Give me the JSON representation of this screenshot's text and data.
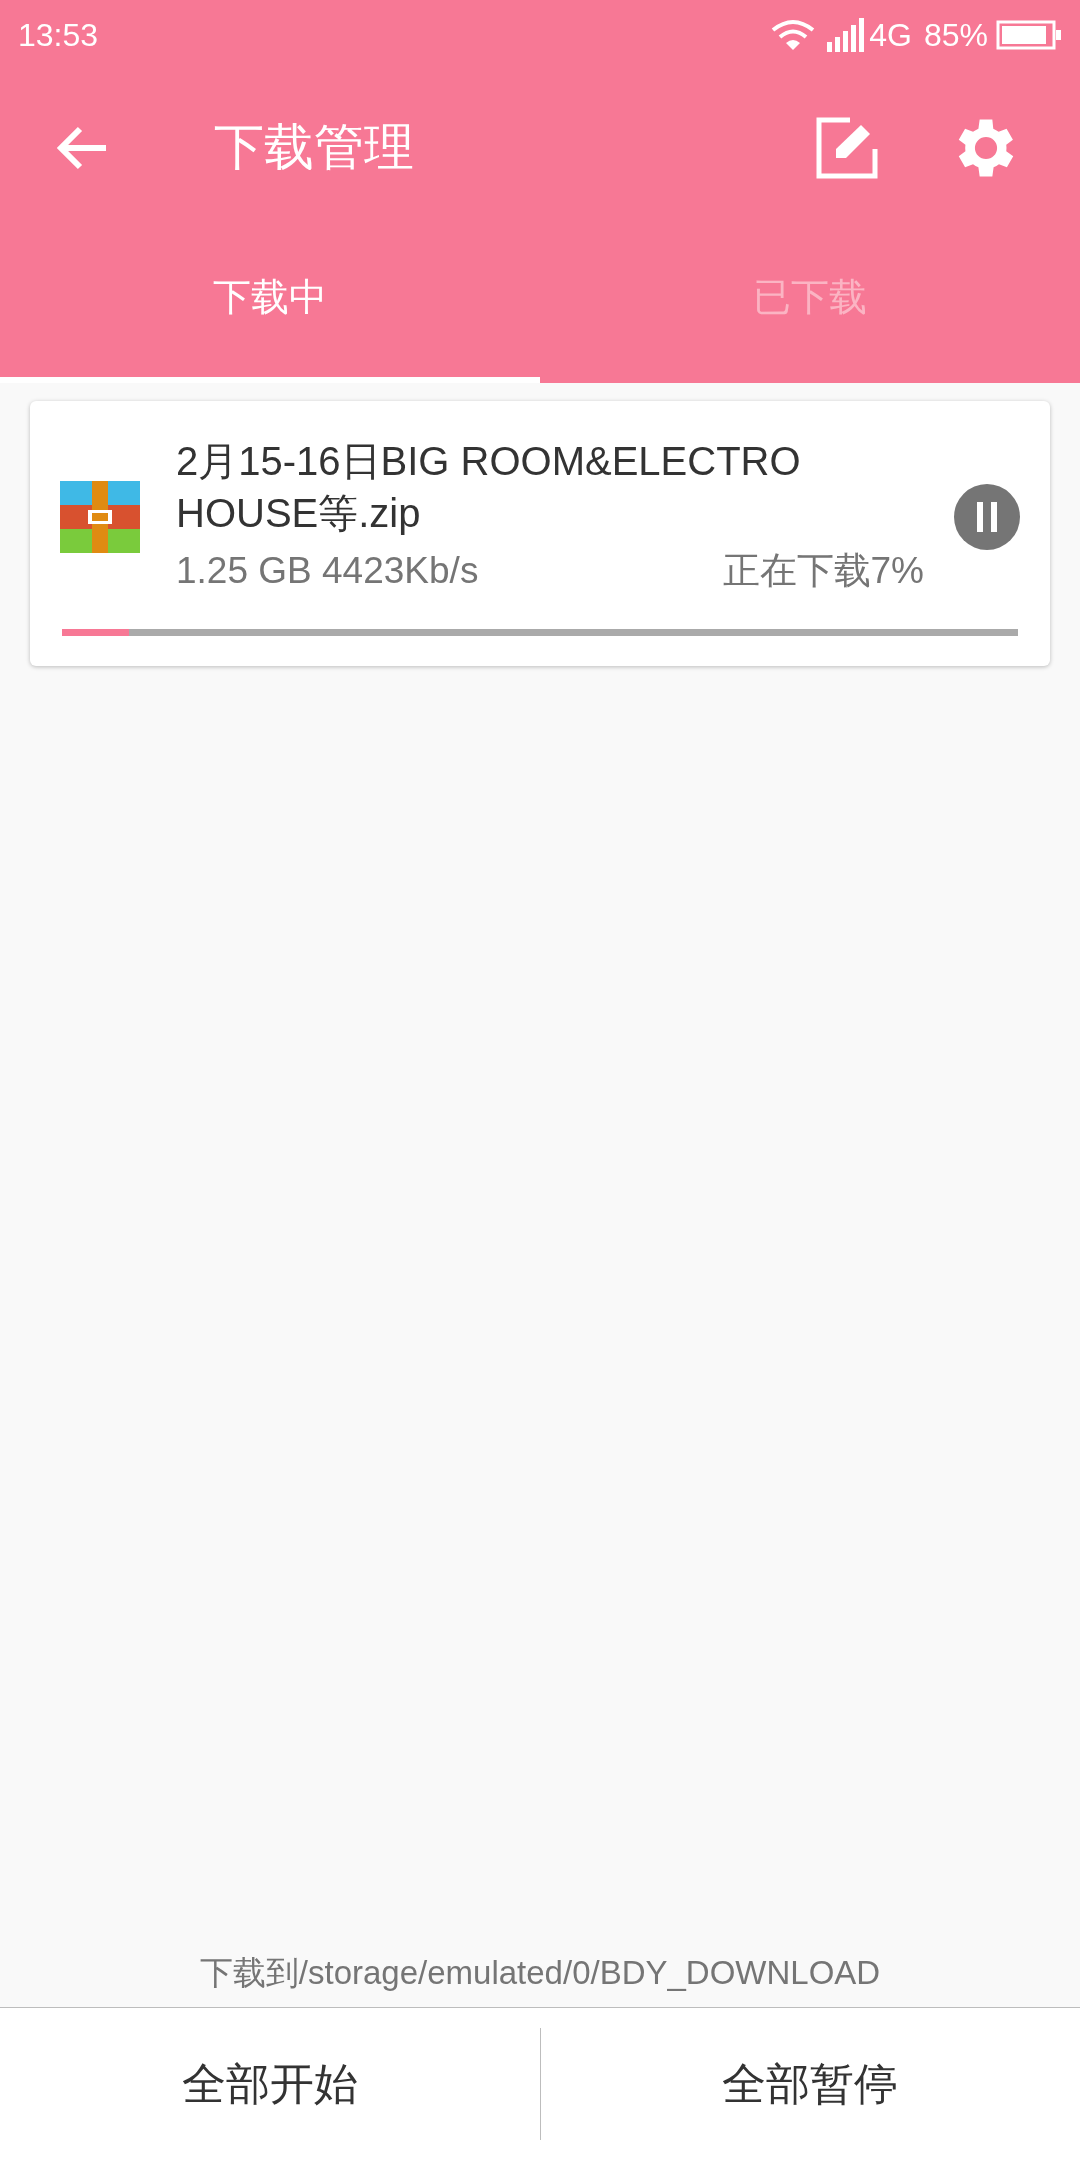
{
  "status_bar": {
    "time": "13:53",
    "network": "4G",
    "battery": "85%"
  },
  "app_bar": {
    "title": "下载管理"
  },
  "tabs": [
    {
      "label": "下载中",
      "selected": true
    },
    {
      "label": "已下载",
      "selected": false
    }
  ],
  "downloads": [
    {
      "name": "2月15-16日BIG ROOM&ELECTRO HOUSE等.zip",
      "size_speed": "1.25 GB 4423Kb/s",
      "status": "正在下载7%",
      "level": 0.07,
      "paused": false
    }
  ],
  "footer": {
    "path": "下载到/storage/emulated/0/BDY_DOWNLOAD"
  },
  "buttons": [
    "全部开始",
    "全部暂停"
  ]
}
